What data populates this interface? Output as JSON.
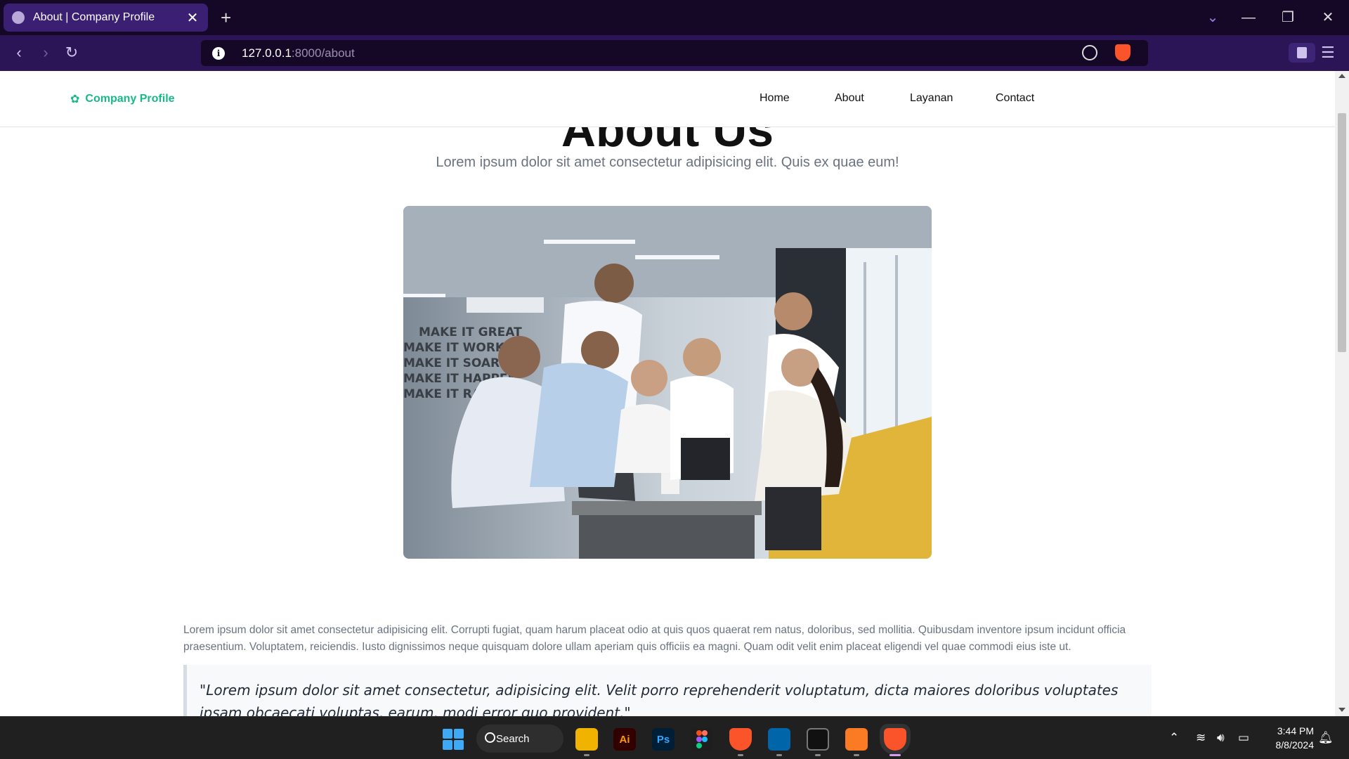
{
  "browser": {
    "tab_title": "About | Company Profile",
    "tab_close": "✕",
    "new_tab": "+",
    "url_host": "127.0.0.1",
    "url_path": ":8000/about",
    "info_glyph": "i",
    "icons": [
      "globe-icon",
      "close-icon",
      "plus-icon",
      "chevron-down-icon",
      "minimize-icon",
      "restore-icon",
      "close-window-icon",
      "back-icon",
      "forward-icon",
      "reload-icon",
      "info-icon",
      "zoom-icon",
      "brave-shield-icon",
      "profile-icon",
      "menu-icon"
    ]
  },
  "site": {
    "brand": "Company Profile",
    "brand_icon": "✿",
    "nav": [
      "Home",
      "About",
      "Layanan",
      "Contact"
    ],
    "heading_1": "About",
    "heading_2": "Us",
    "subtitle": "Lorem ipsum dolor sit amet consectetur adipisicing elit. Quis ex quae eum!",
    "paragraph": "Lorem ipsum dolor sit amet consectetur adipisicing elit. Corrupti fugiat, quam harum placeat odio at quis quos quaerat rem natus, doloribus, sed mollitia. Quibusdam inventore ipsum incidunt officia praesentium. Voluptatem, reiciendis. Iusto dignissimos neque quisquam dolore ullam aperiam quis officiis ea magni. Quam odit velit enim placeat eligendi vel quae commodi eius iste ut.",
    "quote": "\"Lorem ipsum dolor sit amet consectetur, adipisicing elit. Velit porro reprehenderit voluptatum, dicta maiores doloribus voluptates ipsam obcaecati voluptas, earum, modi error quo provident.\"",
    "hero_wall_text": [
      "MAKE IT GREAT",
      "MAKE IT WORK",
      "MAKE IT SOAR",
      "MAKE IT HAPPEN",
      "MAKE IT RANT"
    ]
  },
  "taskbar": {
    "search_label": "Search",
    "apps": [
      "File Explorer",
      "Ai",
      "Ps",
      "Figma",
      "Brave Beta",
      "VS Code",
      "Terminal",
      "XAMPP",
      "Brave"
    ],
    "time": "3:44 PM",
    "date": "8/8/2024"
  },
  "colors": {
    "accent": "#18b889",
    "highlight": "#6ed6b4",
    "chrome_dark": "#150826",
    "chrome_tab": "#3a1f73"
  }
}
